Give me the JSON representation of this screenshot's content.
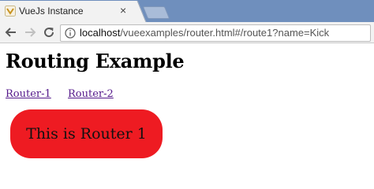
{
  "browser": {
    "tab": {
      "title": "VueJs Instance",
      "close_glyph": "×",
      "icon": "tab-favicon-icon"
    },
    "nav": {
      "back_icon": "back-arrow-icon",
      "forward_icon": "forward-arrow-icon",
      "reload_icon": "reload-icon"
    },
    "address": {
      "host": "localhost",
      "path": "/vueexamples/router.html#/route1?name=Kick",
      "info_icon": "info-icon"
    }
  },
  "page": {
    "title": "Routing Example",
    "links": [
      {
        "label": "Router-1"
      },
      {
        "label": "Router-2"
      }
    ],
    "router_view": {
      "text": "This is Router 1",
      "color": "#ee1b22"
    }
  },
  "colors": {
    "tabbar": "#6f8fbd",
    "visited_link": "#551a8b"
  }
}
